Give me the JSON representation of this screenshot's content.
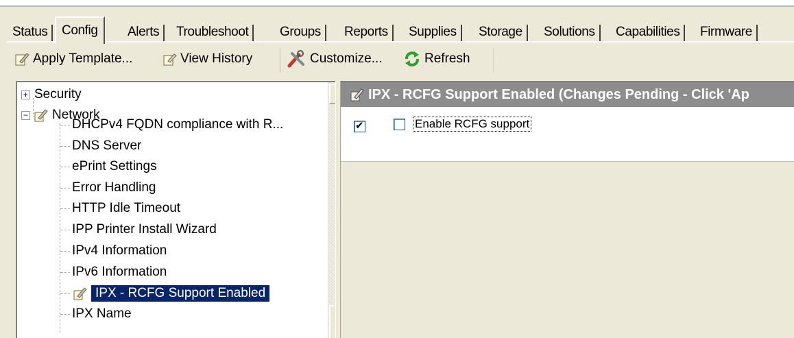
{
  "tabs": [
    "Status",
    "Config",
    "Alerts",
    "Troubleshoot",
    "Groups",
    "Reports",
    "Supplies",
    "Storage",
    "Solutions",
    "Capabilities",
    "Firmware"
  ],
  "active_tab": "Config",
  "toolbar": {
    "apply_template": "Apply Template...",
    "view_history": "View History",
    "customize": "Customize...",
    "refresh": "Refresh"
  },
  "tree": {
    "security": "Security",
    "network": "Network",
    "children": [
      "DHCPv4 FQDN compliance with R...",
      "DNS Server",
      "ePrint Settings",
      "Error Handling",
      "HTTP Idle Timeout",
      "IPP Printer Install Wizard",
      "IPv4 Information",
      "IPv6 Information",
      "IPX - RCFG Support Enabled",
      "IPX Name"
    ],
    "selected": "IPX - RCFG Support Enabled",
    "expander_plus": "+",
    "expander_minus": "−"
  },
  "panel": {
    "title": "IPX - RCFG Support Enabled (Changes Pending - Click 'Ap",
    "apply_checked": true,
    "enable_rcfg_label": "Enable RCFG support",
    "enable_rcfg_checked": false
  },
  "icons": {
    "apply_template": "wrench-document-icon",
    "view_history": "history-icon",
    "customize": "tools-icon",
    "refresh": "refresh-icon",
    "network": "network-settings-icon"
  },
  "colors": {
    "window_bg": "#ece9d8",
    "selection_bg": "#0a246a",
    "panel_header_bg": "#8d8d8d"
  }
}
